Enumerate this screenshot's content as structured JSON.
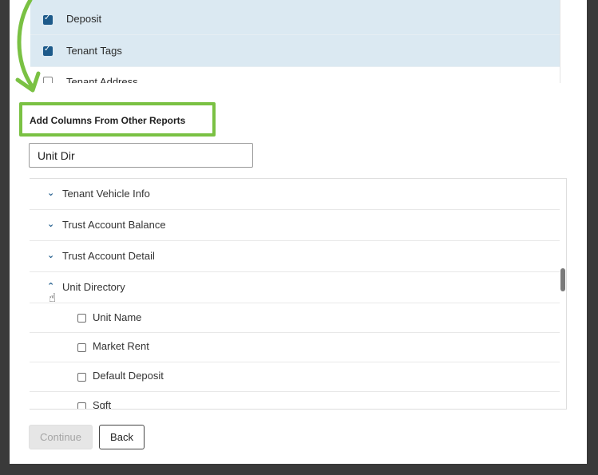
{
  "selected_columns": {
    "items": [
      {
        "label": "Deposit",
        "checked": true
      },
      {
        "label": "Tenant Tags",
        "checked": true
      },
      {
        "label": "Tenant Address",
        "checked": false
      }
    ]
  },
  "other_reports": {
    "heading": "Add Columns From Other Reports",
    "search": {
      "value": "Unit Dir",
      "placeholder": ""
    },
    "reports": [
      {
        "label": "Tenant Vehicle Info",
        "expanded": false
      },
      {
        "label": "Trust Account Balance",
        "expanded": false
      },
      {
        "label": "Trust Account Detail",
        "expanded": false
      },
      {
        "label": "Unit Directory",
        "expanded": true
      }
    ],
    "unit_directory_columns": [
      {
        "label": "Unit Name",
        "checked": false
      },
      {
        "label": "Market Rent",
        "checked": false
      },
      {
        "label": "Default Deposit",
        "checked": false
      },
      {
        "label": "Sqft",
        "checked": false
      }
    ]
  },
  "actions": {
    "continue_label": "Continue",
    "continue_disabled": true,
    "back_label": "Back"
  },
  "colors": {
    "annotation_green": "#7ac143",
    "selected_row_bg": "#dbe9f2",
    "checkbox_checked": "#1d5a8a"
  }
}
